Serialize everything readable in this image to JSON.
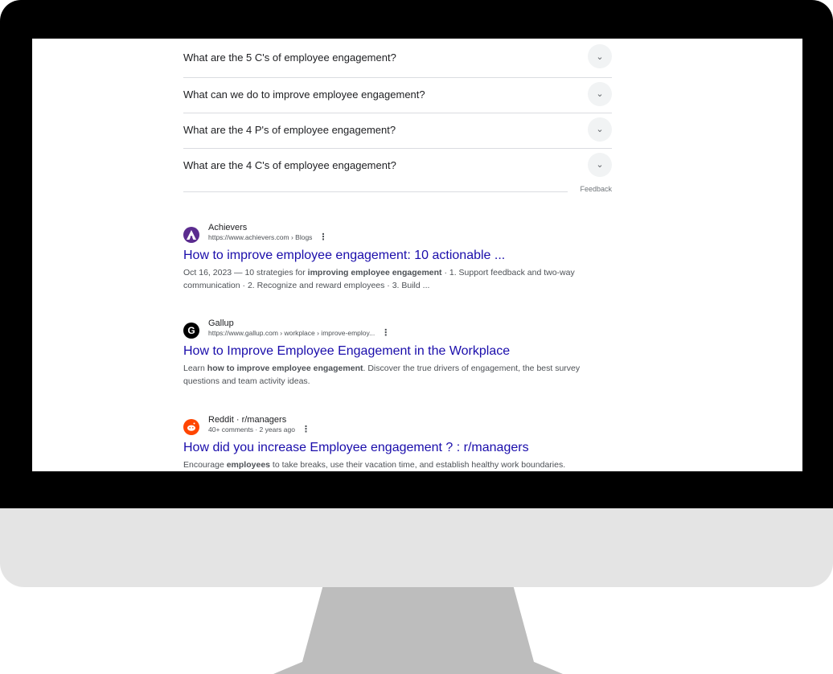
{
  "paa": {
    "questions": [
      "What are the 5 C's of employee engagement?",
      "What can we do to improve employee engagement?",
      "What are the 4 P's of employee engagement?",
      "What are the 4 C's of employee engagement?"
    ],
    "feedback_label": "Feedback"
  },
  "results": [
    {
      "site": "Achievers",
      "url": "https://www.achievers.com › Blogs",
      "title": "How to improve employee engagement: 10 actionable ...",
      "snippet_pre": "Oct 16, 2023 — 10 strategies for ",
      "snippet_bold": "improving employee engagement",
      "snippet_post": " · 1. Support feedback and two-way communication · 2. Recognize and reward employees · 3. Build ...",
      "favicon_color": "#5b2c8f"
    },
    {
      "site": "Gallup",
      "url": "https://www.gallup.com › workplace › improve-employ...",
      "title": "How to Improve Employee Engagement in the Workplace",
      "snippet_pre": "Learn ",
      "snippet_bold": "how to improve employee engagement",
      "snippet_post": ". Discover the true drivers of engagement, the best survey questions and team activity ideas.",
      "favicon_color": "#000000"
    },
    {
      "site": "Reddit · r/managers",
      "url": "40+ comments · 2 years ago",
      "title": "How did you increase Employee engagement ? : r/managers",
      "snippet_pre": "Encourage ",
      "snippet_bold": "employees",
      "snippet_post": " to take breaks, use their vacation time, and establish healthy work boundaries.",
      "favicon_color": "#ff4500"
    }
  ],
  "icons": {
    "expand": "chevron-down-icon",
    "more": "more-vert-icon"
  }
}
